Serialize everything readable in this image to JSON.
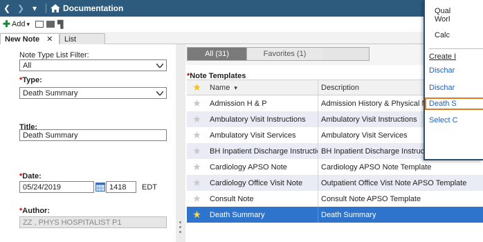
{
  "titlebar": {
    "title": "Documentation",
    "back": "❮",
    "forward": "❯",
    "dropdown": "▾"
  },
  "toolbar": {
    "add_label": "Add",
    "add_caret": "▾"
  },
  "tabs": [
    {
      "label": "New Note",
      "close": "✕"
    },
    {
      "label": "List"
    }
  ],
  "form": {
    "note_type_filter_label": "Note Type List Filter:",
    "note_type_filter_value": "All",
    "type_label": "Type:",
    "type_value": "Death Summary",
    "title_label": "Title:",
    "title_value": "Death Summary",
    "date_label": "Date:",
    "date_value": "05/24/2019",
    "time_value": "1418",
    "timezone": "EDT",
    "author_label": "Author:",
    "author_value": "ZZ , PHYS HOSPITALIST P1",
    "required_marker": "*"
  },
  "segment": {
    "all_label": "All (31)",
    "favorites_label": "Favorites (1)"
  },
  "templates": {
    "title": "Note Templates",
    "required_marker": "*",
    "columns": {
      "name": "Name",
      "sort_indicator": "▾",
      "description": "Description"
    },
    "rows": [
      {
        "name": "Admission H & P",
        "description": "Admission History & Physical Note"
      },
      {
        "name": "Ambulatory Visit Instructions",
        "description": "Ambulatory Visit Instructions"
      },
      {
        "name": "Ambulatory Visit Services",
        "description": "Ambulatory Visit Services"
      },
      {
        "name": "BH Inpatient Discharge Instructions",
        "description": "BH Inpatient Discharge Instructions"
      },
      {
        "name": "Cardiology APSO Note",
        "description": "Cardiology APSO Note Template"
      },
      {
        "name": "Cardiology Office Visit Note",
        "description": "Outpatient Office Vist Note APSO Template"
      },
      {
        "name": "Consult Note",
        "description": "Consult Note APSO Template"
      },
      {
        "name": "Death Summary",
        "description": "Death Summary"
      }
    ]
  },
  "popup": {
    "line1": "Qual",
    "line2": "Worl",
    "line3": "Calc",
    "line4": "Create I",
    "line5": "Dischar",
    "line6": "Dischar",
    "line7": "Death S",
    "line8": "Select C"
  },
  "colors": {
    "titlebar": "#2c5b7d",
    "selection": "#2f74cc",
    "highlight_border": "#e07a1e",
    "link": "#1f5fb5"
  }
}
